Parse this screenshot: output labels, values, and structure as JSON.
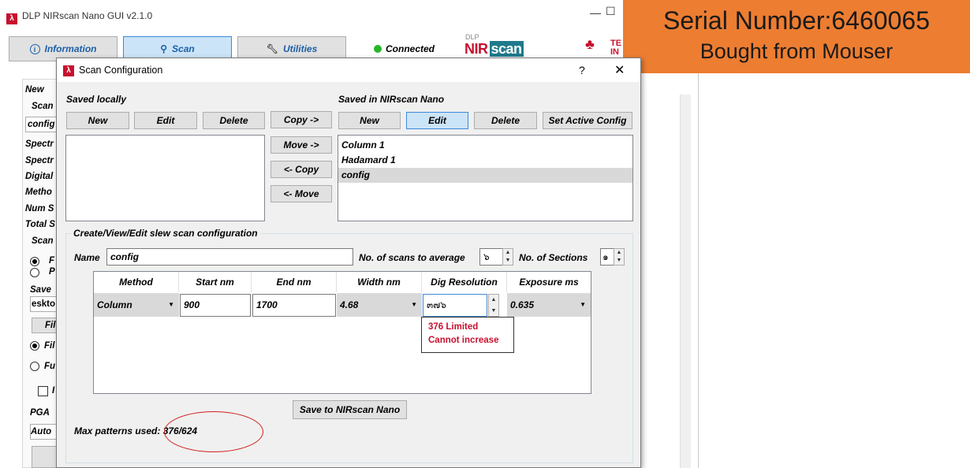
{
  "main_window": {
    "title": "DLP NIRscan Nano GUI v2.1.0",
    "minimize_glyph": "—",
    "maximize_glyph": "☐",
    "tabs": [
      {
        "label": "Information",
        "icon": "info-icon"
      },
      {
        "label": "Scan",
        "icon": "search-icon"
      },
      {
        "label": "Utilities",
        "icon": "wrench-icon"
      }
    ],
    "status": "Connected",
    "status_color": "#28b628",
    "nir_logo_top": "DLP",
    "nir_logo": "NIR",
    "nir_logo_suffix": "scan",
    "ti_logo_glyph": "♣",
    "ti_text_1": "TE",
    "ti_text_2": "IN",
    "left_panel": {
      "new_label": "New",
      "scan_label": "Scan",
      "config_value": "config",
      "rows": [
        "Spectr",
        "Spectr",
        "Digital",
        "Metho",
        "Num S",
        "Total S"
      ],
      "scan_group": "Scan",
      "radio_1": "F",
      "radio_2": "P",
      "save_label": "Save",
      "path_value": "eskto",
      "file_btn": "Fil",
      "radio_file": "Fil",
      "radio_fu": "Fu",
      "checkbox_label": "I",
      "pga_label": "PGA",
      "auto_value": "Auto"
    },
    "scroll_up_glyph": "▲"
  },
  "dialog": {
    "title": "Scan Configuration",
    "help_glyph": "?",
    "close_glyph": "✕",
    "saved_locally": {
      "title": "Saved locally",
      "new": "New",
      "edit": "Edit",
      "delete": "Delete",
      "items": []
    },
    "transfer": {
      "copy_right": "Copy ->",
      "move_right": "Move ->",
      "copy_left": "<- Copy",
      "move_left": "<- Move"
    },
    "saved_device": {
      "title": "Saved in NIRscan Nano",
      "new": "New",
      "edit": "Edit",
      "delete": "Delete",
      "set_active": "Set Active Config",
      "items": [
        "Column 1",
        "Hadamard 1",
        "config"
      ],
      "selected": "config"
    },
    "edit_group": {
      "title": "Create/View/Edit  slew scan configuration",
      "name_label": "Name",
      "name_value": "config",
      "num_scans_label": "No. of scans to average",
      "num_scans_value": "๖",
      "num_sections_label": "No. of Sections",
      "num_sections_value": "๑",
      "spin_up": "▲",
      "spin_down": "▼",
      "dropdown_glyph": "▼",
      "columns": [
        "Method",
        "Start nm",
        "End nm",
        "Width nm",
        "Dig Resolution",
        "Exposure ms"
      ],
      "row": {
        "method": "Column",
        "start_nm": "900",
        "end_nm": "1700",
        "width_nm": "4.68",
        "dig_resolution": "๓๗๖",
        "exposure_ms": "0.635"
      },
      "tooltip_line1": "376 Limited",
      "tooltip_line2": "Cannot increase",
      "tooltip_color": "#c8102e",
      "save_button": "Save to NIRscan Nano",
      "max_patterns": "Max patterns used: 376/624",
      "highlight_color": "#d12020"
    }
  },
  "annotation": {
    "line1": "Serial Number:6460065",
    "line2": "Bought  from Mouser",
    "background": "#ed7d31"
  }
}
